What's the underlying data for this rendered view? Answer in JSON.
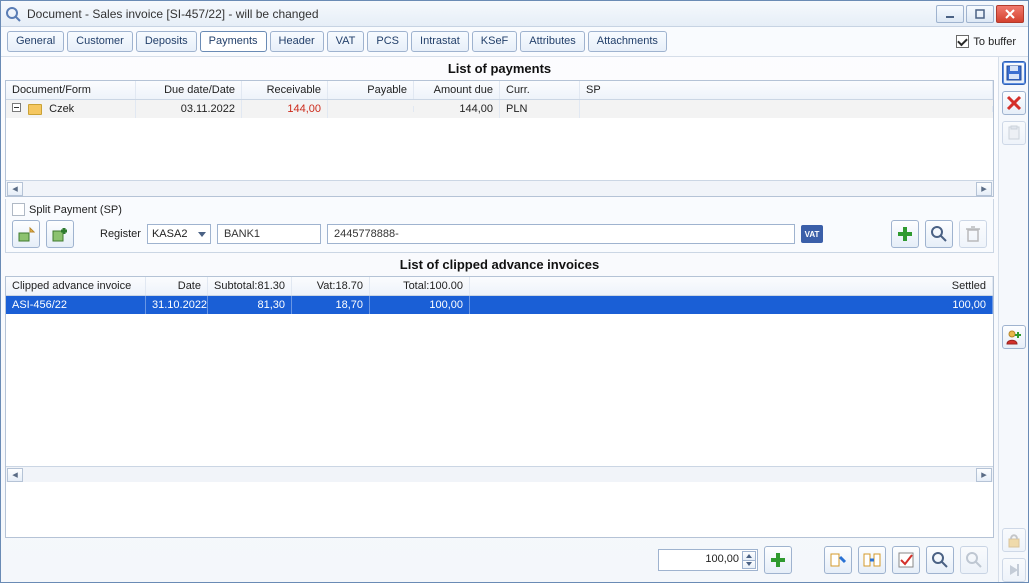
{
  "window": {
    "title": "Document - Sales invoice [SI-457/22]  - will be changed"
  },
  "tabs": [
    "General",
    "Customer",
    "Deposits",
    "Payments",
    "Header",
    "VAT",
    "PCS",
    "Intrastat",
    "KSeF",
    "Attributes",
    "Attachments"
  ],
  "activeTab": 3,
  "toBuffer": {
    "label": "To buffer",
    "checked": true
  },
  "payments": {
    "title": "List of payments",
    "columns": [
      "Document/Form",
      "Due date/Date",
      "Receivable",
      "Payable",
      "Amount due",
      "Curr.",
      "SP"
    ],
    "rows": [
      {
        "form": "Czek",
        "dueDate": "03.11.2022",
        "receivable": "144,00",
        "payable": "",
        "amountDue": "144,00",
        "curr": "PLN",
        "sp": ""
      }
    ]
  },
  "splitPayment": {
    "label": "Split Payment (SP)",
    "checked": false
  },
  "register": {
    "label": "Register",
    "selected": "KASA2",
    "bank": "BANK1",
    "account": "2445778888-",
    "vatBadge": "VAT"
  },
  "clipped": {
    "title": "List of clipped advance invoices",
    "columns": [
      "Clipped advance invoice",
      "Date",
      "Subtotal:81.30",
      "Vat:18.70",
      "Total:100.00",
      "Settled"
    ],
    "rows": [
      {
        "inv": "ASI-456/22",
        "date": "31.10.2022",
        "subtotal": "81,30",
        "vat": "18,70",
        "total": "100,00",
        "settled": "100,00"
      }
    ]
  },
  "bottom": {
    "value": "100,00"
  }
}
